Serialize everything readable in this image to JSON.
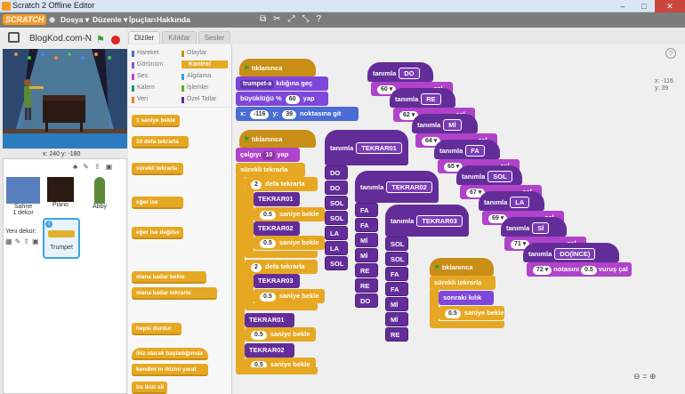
{
  "window": {
    "title": "Scratch 2 Offline Editor"
  },
  "menu": {
    "logo": "SCRATCH",
    "items": [
      "Dosya ▾",
      "Düzenle ▾",
      "İpuçları",
      "Hakkında"
    ]
  },
  "stage_header": {
    "project_name": "BlogKod.com-N"
  },
  "stage": {
    "coords": "x: 240  y: -180"
  },
  "sprites": {
    "stage_label": "Sahne",
    "stage_sub": "1 dekor",
    "new_backdrop": "Yeni dekor:",
    "items": [
      "Piano",
      "Abby",
      "Trumpet"
    ]
  },
  "tabs": [
    "Diziler",
    "Kılıklar",
    "Sesler"
  ],
  "categories": [
    {
      "name": "Hareket",
      "color": "#4a6cd4"
    },
    {
      "name": "Olaylar",
      "color": "#c88e16"
    },
    {
      "name": "Görünüm",
      "color": "#8a55d7"
    },
    {
      "name": "Kontrol",
      "color": "#e6a822"
    },
    {
      "name": "Ses",
      "color": "#bb42c3"
    },
    {
      "name": "Algılama",
      "color": "#2ca5e2"
    },
    {
      "name": "Kalem",
      "color": "#0e9a6c"
    },
    {
      "name": "İşlemler",
      "color": "#5cb712"
    },
    {
      "name": "Veri",
      "color": "#ee7d16"
    },
    {
      "name": "Özel Tatlar",
      "color": "#632d99"
    }
  ],
  "palette": [
    "1 saniye bekle",
    "10 defa tekrarla",
    "sürekli tekrarla",
    "eğer ise",
    "eğer ise değilse",
    "olana kadar bekle",
    "olana kadar tekrarla",
    "hepsi durdur",
    "ikiz olarak başladığımda",
    "kendini in ikizini yarat",
    "bu ikizi sil"
  ],
  "scripts": {
    "s1": {
      "hat": "tıklanınca",
      "l1a": "trumpet-a",
      "l1b": "kılığına geç",
      "l2a": "büyüklüğü",
      "l2b": "60",
      "l2c": "yap",
      "l3a": "-116",
      "l3b": "39",
      "l3c": "noktasına git",
      "xlabel": "x:",
      "ylabel": "y:",
      "pct": "%"
    },
    "s2": {
      "hat": "tıklanınca",
      "l1a": "çalgıyı",
      "l1b": "10",
      "l1c": "yap",
      "forever": "sürekli tekrarla",
      "rep": "defa tekrarla",
      "n2": "2",
      "t1": "TEKRAR01",
      "t2": "TEKRAR02",
      "t3": "TEKRAR03",
      "wait": "saniye bekle",
      "w": "0.5"
    },
    "s3": {
      "hat": "tıklanınca",
      "forever": "sürekli tekrarla",
      "next": "sonraki kılık",
      "w": "0.5",
      "wait": "saniye bekle"
    },
    "defs": {
      "define": "tanımla",
      "notes": [
        {
          "name": "DO",
          "num": "60"
        },
        {
          "name": "RE",
          "num": "62"
        },
        {
          "name": "Mİ",
          "num": "64"
        },
        {
          "name": "FA",
          "num": "65"
        },
        {
          "name": "SOL",
          "num": "67"
        },
        {
          "name": "LA",
          "num": "69"
        },
        {
          "name": "Sİ",
          "num": "71"
        },
        {
          "name": "DO(İNCE)",
          "num": "72"
        }
      ],
      "play": "notasını",
      "beats": "0.5",
      "beats_word": "vuruş çal",
      "cal": "çal"
    },
    "tekrar01": [
      "DO",
      "DO",
      "SOL",
      "SOL",
      "LA",
      "LA",
      "SOL"
    ],
    "tekrar02": [
      "FA",
      "FA",
      "Mİ",
      "Mİ",
      "RE",
      "RE",
      "DO"
    ],
    "tekrar03": [
      "SOL",
      "SOL",
      "FA",
      "FA",
      "Mİ",
      "Mİ",
      "RE"
    ]
  },
  "sprite_info": {
    "x": "x: -116",
    "y": "y: 39"
  }
}
